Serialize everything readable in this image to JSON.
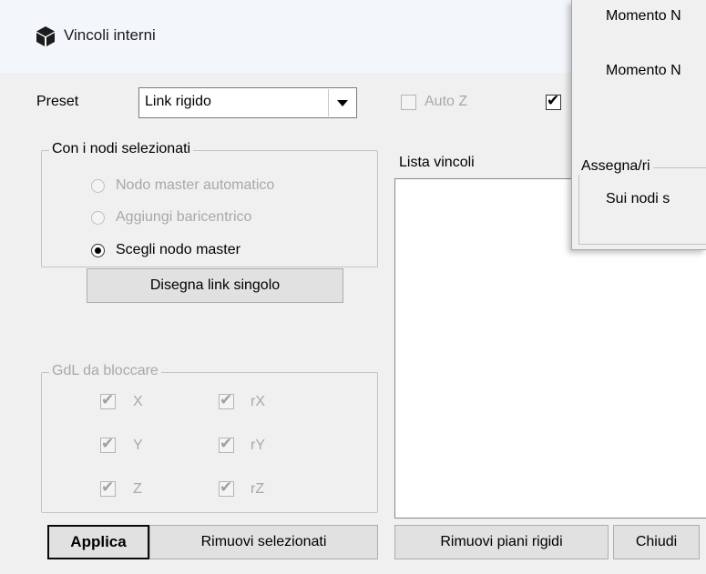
{
  "window": {
    "title": "Vincoli interni",
    "icon": "cube-icon"
  },
  "preset": {
    "label": "Preset",
    "value": "Link rigido"
  },
  "auto_z": {
    "label": "Auto Z",
    "checked": false,
    "enabled": false
  },
  "extra_checkbox": {
    "checked": true
  },
  "nodes_group": {
    "title": "Con i nodi selezionati",
    "options": [
      {
        "label": "Nodo master automatico",
        "selected": false,
        "enabled": false
      },
      {
        "label": "Aggiungi baricentrico",
        "selected": false,
        "enabled": false
      },
      {
        "label": "Scegli nodo master",
        "selected": true,
        "enabled": true
      }
    ],
    "draw_button": "Disegna link singolo"
  },
  "dof_group": {
    "title": "GdL da bloccare",
    "items": [
      {
        "label": "X",
        "checked": true
      },
      {
        "label": "rX",
        "checked": true
      },
      {
        "label": "Y",
        "checked": true
      },
      {
        "label": "rY",
        "checked": true
      },
      {
        "label": "Z",
        "checked": true
      },
      {
        "label": "rZ",
        "checked": true
      }
    ]
  },
  "constraints_list": {
    "label": "Lista vincoli",
    "items": []
  },
  "buttons": {
    "apply": "Applica",
    "remove_selected": "Rimuovi selezionati",
    "remove_rigid_planes": "Rimuovi piani rigidi",
    "close": "Chiudi"
  },
  "overlay_panel": {
    "row1": "Momento N",
    "row2": "Momento N",
    "group_title": "Assegna/ri",
    "group_text": "Sui nodi s"
  }
}
